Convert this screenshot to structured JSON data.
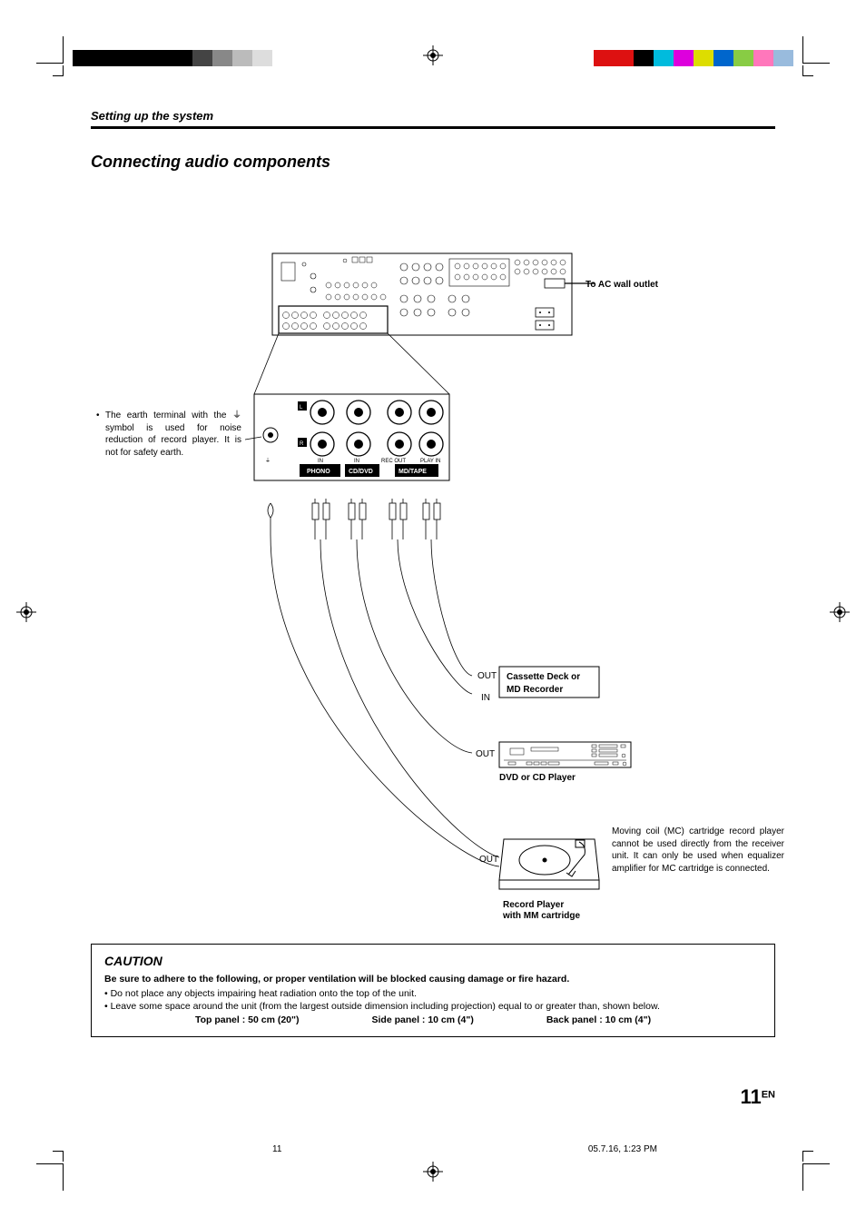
{
  "breadcrumb": "Setting up the system",
  "section_title": "Connecting audio components",
  "ac_label": "To AC wall outlet",
  "earth_note": "The earth terminal with the ⏚ symbol is used for noise reduction of record player. It is not for safety earth.",
  "jacks": {
    "phono": "PHONO",
    "cddvd": "CD/DVD",
    "mdtape": "MD/TAPE",
    "in": "IN",
    "recout": "REC OUT",
    "playin": "PLAY IN",
    "l": "L",
    "r": "R"
  },
  "blocks": {
    "cassette": "Cassette Deck or MD Recorder",
    "dvd": "DVD or CD Player",
    "record": "Record Player\nwith MM cartridge",
    "out": "OUT",
    "in": "IN"
  },
  "mc_note": "Moving coil (MC) cartridge record player cannot be used directly from the receiver unit. It can only be used when equalizer amplifier for MC cartridge is connected.",
  "caution": {
    "title": "CAUTION",
    "lead": "Be sure to adhere to the following, or proper ventilation will be blocked causing damage or fire hazard.",
    "line1": "• Do not place any objects impairing heat radiation onto the top of the unit.",
    "line2": "• Leave some space around the unit (from the largest outside dimension including projection) equal to or greater than, shown below.",
    "top": "Top panel : 50 cm (20\")",
    "side": "Side panel : 10 cm (4\")",
    "back": "Back panel : 10 cm (4\")"
  },
  "page_number": "11",
  "page_lang": "EN",
  "footer": {
    "pg": "11",
    "date": "05.7.16, 1:23 PM"
  },
  "colorbars": {
    "left": [
      "#000",
      "#000",
      "#000",
      "#000",
      "#000",
      "#000",
      "#444",
      "#888",
      "#bbb",
      "#ddd"
    ],
    "right": [
      "#d11",
      "#d11",
      "#000",
      "#0bd",
      "#d0d",
      "#dd0",
      "#06c",
      "#8c4",
      "#f7b",
      "#9bd"
    ]
  }
}
